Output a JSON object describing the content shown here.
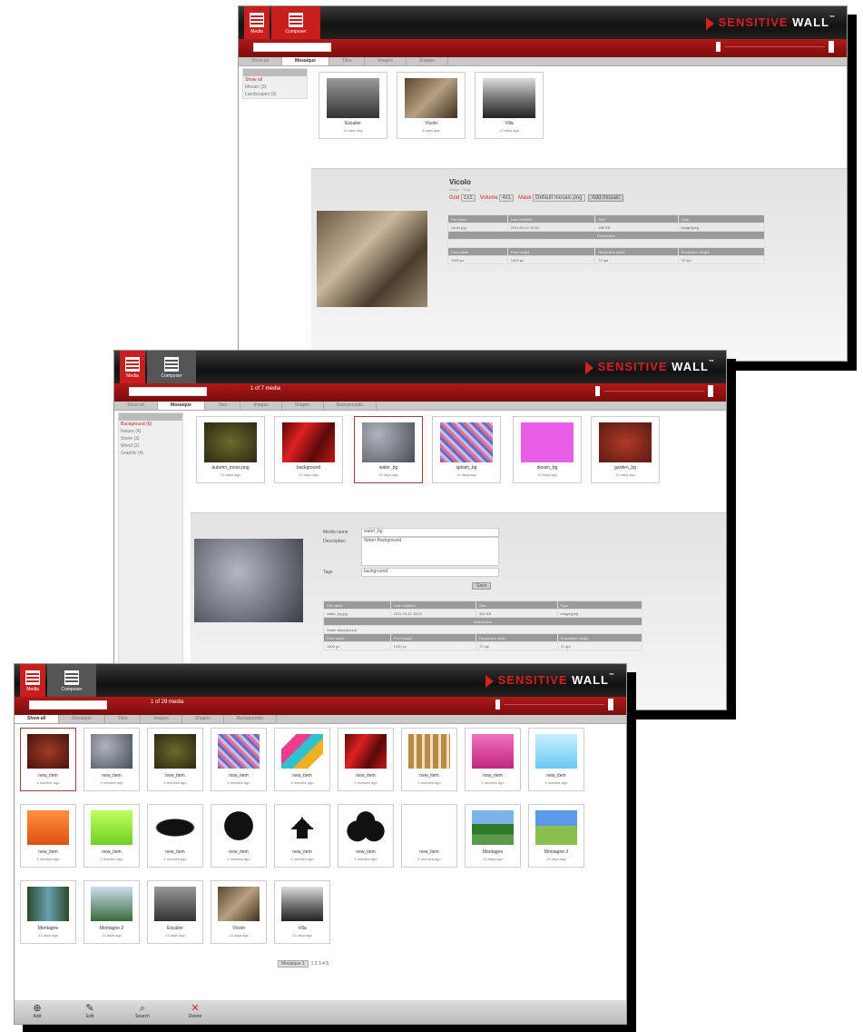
{
  "brand": {
    "part1": "SENSITIVE",
    "part2": "WALL",
    "tm": "™"
  },
  "nav": {
    "media": "Media",
    "composer": "Composer"
  },
  "window1": {
    "tabs": [
      "Show all",
      "Mosaique",
      "Tiles",
      "Images",
      "Shapes",
      "Backgrounds"
    ],
    "active_tab": 1,
    "side_items": [
      "Show all",
      "Mosaic (3)",
      "Landscapes (3)"
    ],
    "thumbs": [
      {
        "name": "Escalier",
        "time": "13 days ago"
      },
      {
        "name": "Vicolo",
        "time": "8 days ago"
      },
      {
        "name": "Villa",
        "time": "13 days ago"
      }
    ],
    "detail": {
      "title": "Vicolo",
      "subtitle": "Image · Crop",
      "grid_label": "Grid",
      "grid_value": "1x1",
      "volume_label": "Volume",
      "volume_value": "4x1",
      "mask_label": "Mask",
      "mask_value": "Default mosaic.png",
      "button": "Add mosaic",
      "headers": [
        "File name",
        "Last modified",
        "Size",
        "Type"
      ],
      "row": [
        "vicolo.jpg",
        "2011-03-12 15:01",
        "188 KB",
        "image/jpeg"
      ],
      "section": "Description",
      "headers2": [
        "Pixel width",
        "Pixel height",
        "Resolution width",
        "Resolution height"
      ],
      "row2": [
        "1500 px",
        "1000 px",
        "72 dpi",
        "72 dpi"
      ]
    }
  },
  "window2": {
    "count": "1 of 7 media",
    "tabs": [
      "Show all",
      "Mosaique",
      "Tiles",
      "Images",
      "Shapes",
      "Backgrounds"
    ],
    "active_tab": 1,
    "side_items": [
      "Background (6)",
      "Nature (4)",
      "Stone (3)",
      "Wood (2)",
      "Graphic (4)"
    ],
    "thumbs": [
      {
        "name": "autumn_moss.png",
        "time": "13 days ago"
      },
      {
        "name": "background",
        "time": "13 days ago"
      },
      {
        "name": "water_bg",
        "time": "12 days ago"
      },
      {
        "name": "splash_bg",
        "time": "12 days ago"
      },
      {
        "name": "dessin_bg",
        "time": "13 days ago"
      },
      {
        "name": "garden_bg",
        "time": "13 days ago"
      }
    ],
    "detail": {
      "media_name_label": "Media name",
      "media_name": "water_bg",
      "desc_label": "Description",
      "desc": "Water Background",
      "tags_label": "Tags",
      "tags": "background",
      "button": "Save",
      "headers": [
        "File name",
        "Last modified",
        "Size",
        "Type"
      ],
      "row": [
        "water_bg.jpg",
        "2011-03-12 13:01",
        "302 KB",
        "image/jpeg"
      ],
      "section": "Description",
      "desc_row": "Water Background",
      "headers2": [
        "Pixel width",
        "Pixel height",
        "Resolution width",
        "Resolution height"
      ],
      "row2": [
        "1500 px",
        "1000 px",
        "72 dpi",
        "72 dpi"
      ]
    }
  },
  "window3": {
    "count": "1 of 29 media",
    "tabs": [
      "Show all",
      "Mosaique",
      "Tiles",
      "Images",
      "Shapes",
      "Backgrounds"
    ],
    "active_tab": 0,
    "thumbs": [
      {
        "name": "new_item",
        "time": "4 minutes ago"
      },
      {
        "name": "new_item",
        "time": "4 minutes ago"
      },
      {
        "name": "new_item",
        "time": "4 minutes ago"
      },
      {
        "name": "new_item",
        "time": "4 minutes ago"
      },
      {
        "name": "new_item",
        "time": "4 minutes ago"
      },
      {
        "name": "new_item",
        "time": "4 minutes ago"
      },
      {
        "name": "new_item",
        "time": "4 minutes ago"
      },
      {
        "name": "new_item",
        "time": "4 minutes ago"
      },
      {
        "name": "new_item",
        "time": "4 minutes ago"
      },
      {
        "name": "new_item",
        "time": "4 minutes ago"
      },
      {
        "name": "new_item",
        "time": "4 minutes ago"
      },
      {
        "name": "new_item",
        "time": "4 minutes ago"
      },
      {
        "name": "new_item",
        "time": "4 minutes ago"
      },
      {
        "name": "new_item",
        "time": "4 minutes ago"
      },
      {
        "name": "new_item",
        "time": "4 minutes ago"
      },
      {
        "name": "new_item",
        "time": "4 minutes ago"
      },
      {
        "name": "Montagne",
        "time": "13 days ago"
      },
      {
        "name": "Montagne 2",
        "time": "13 days ago"
      },
      {
        "name": "Montagne",
        "time": "13 days ago"
      },
      {
        "name": "Montagne 2",
        "time": "13 days ago"
      },
      {
        "name": "Escalier",
        "time": "13 days ago"
      },
      {
        "name": "Vicolo",
        "time": "13 days ago"
      },
      {
        "name": "Villa",
        "time": "13 days ago"
      }
    ],
    "pager": {
      "select": "Mosaique 1",
      "pages": "1 2 3 4 5"
    },
    "bottom": [
      "Add",
      "Edit",
      "Search",
      "Delete"
    ]
  }
}
